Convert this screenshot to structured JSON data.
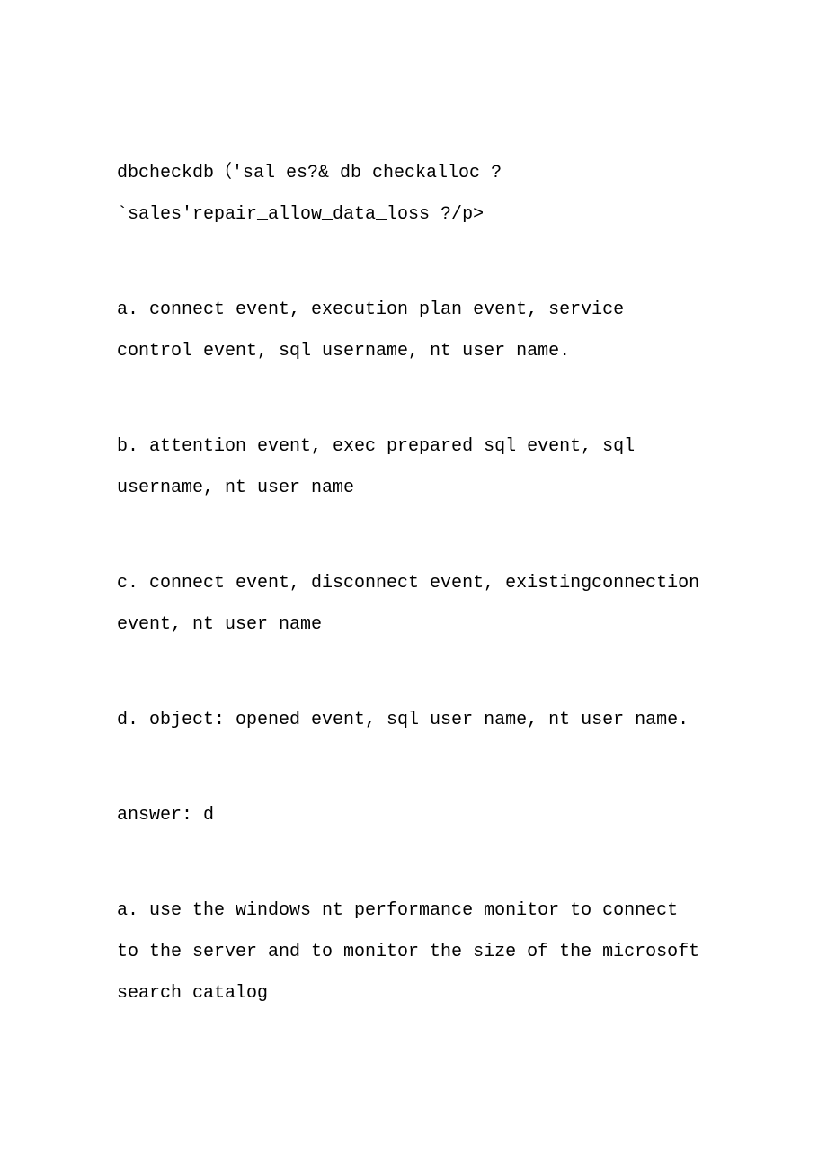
{
  "paragraphs": [
    "dbcheckdb（'sal es?& db checkalloc ?`sales'repair_allow_data_loss ?/p>",
    "a. connect event, execution plan event, service control event, sql username, nt user name.",
    "b. attention event, exec prepared sql event, sql username, nt user name",
    "c. connect event, disconnect event, existingconnection event, nt user name",
    "d. object: opened event, sql user name, nt user name.",
    "answer: d",
    "a. use the windows nt performance monitor to connect to the server and to monitor the size of the microsoft search catalog"
  ]
}
